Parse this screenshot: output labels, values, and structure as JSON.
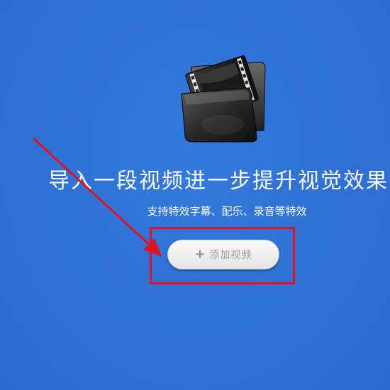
{
  "intro": {
    "headline": "导入一段视频进一步提升视觉效果",
    "subtitle": "支持特效字幕、配乐、录音等特效"
  },
  "add_video": {
    "icon": "plus-icon",
    "plus_glyph": "+",
    "label": "添加视频"
  },
  "illustration": {
    "icon": "film-folder-icon"
  },
  "annotation": {
    "arrow_color": "#e81020",
    "box_color": "#e81020"
  },
  "colors": {
    "background": "#2f72d6",
    "text": "#ffffff",
    "button_text": "#9b9b9b"
  }
}
